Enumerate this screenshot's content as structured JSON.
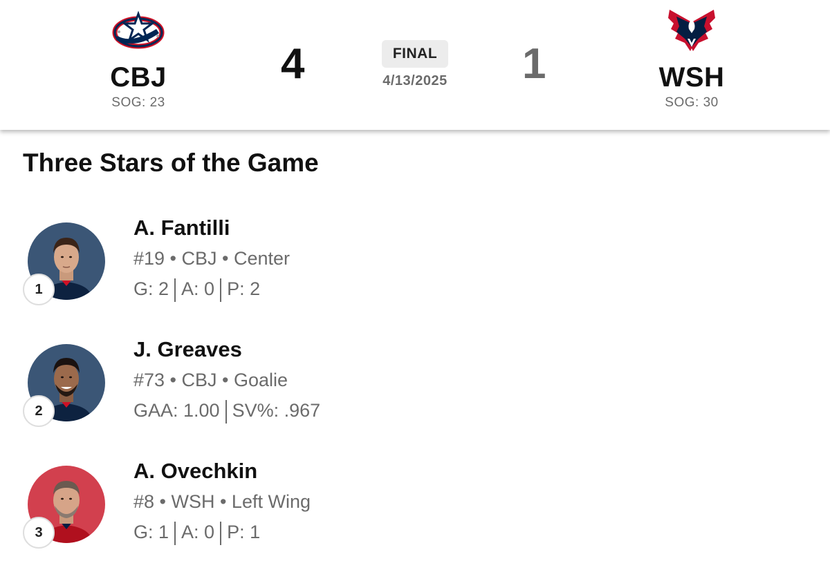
{
  "game": {
    "away": {
      "abbr": "CBJ",
      "score": "4",
      "sog": "SOG: 23",
      "logo": "blue-jackets-logo"
    },
    "home": {
      "abbr": "WSH",
      "score": "1",
      "sog": "SOG: 30",
      "logo": "capitals-eagle-logo"
    },
    "status": "FINAL",
    "date": "4/13/2025"
  },
  "stars_title": "Three Stars of the Game",
  "stars": [
    {
      "rank": "1",
      "name": "A. Fantilli",
      "meta": "#19 • CBJ • Center",
      "stats": [
        "G: 2",
        "A: 0",
        "P: 2"
      ],
      "avatar_bg": "#3b5676"
    },
    {
      "rank": "2",
      "name": "J. Greaves",
      "meta": "#73 • CBJ • Goalie",
      "stats": [
        "GAA: 1.00",
        "SV%: .967"
      ],
      "avatar_bg": "#3b5676"
    },
    {
      "rank": "3",
      "name": "A. Ovechkin",
      "meta": "#8 • WSH • Left Wing",
      "stats": [
        "G: 1",
        "A: 0",
        "P: 1"
      ],
      "avatar_bg": "#d2404e"
    }
  ],
  "colors": {
    "cbj_navy": "#002654",
    "cbj_red": "#ce1126",
    "wsh_red": "#c8102e",
    "wsh_navy": "#041e42",
    "muted_text": "#6b6b6b"
  }
}
